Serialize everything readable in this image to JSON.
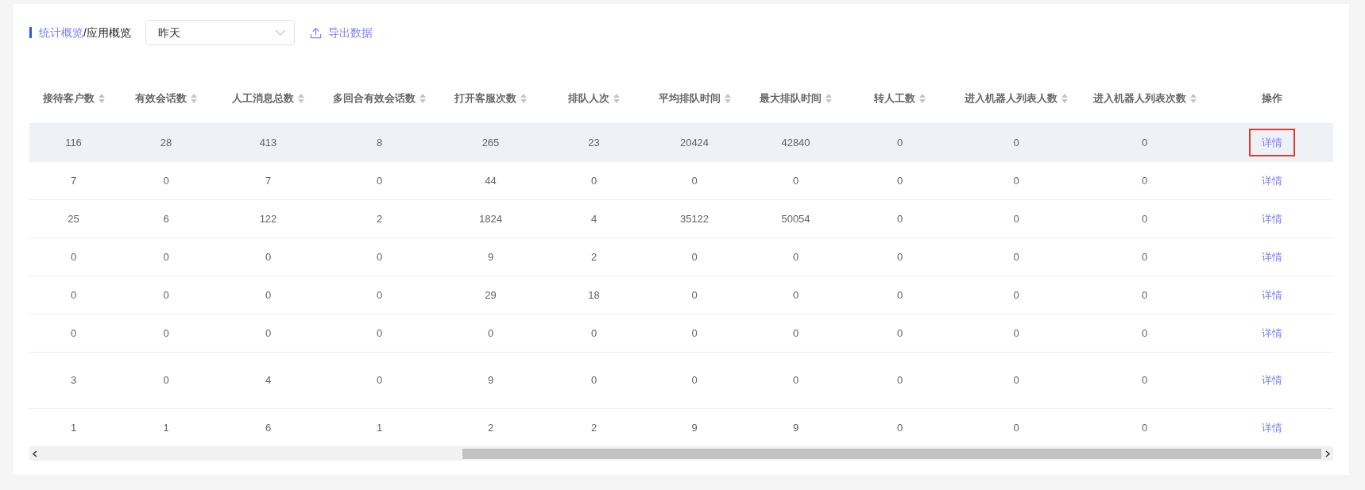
{
  "breadcrumb": {
    "parent": "统计概览",
    "separator": "/",
    "current": "应用概览"
  },
  "date_select": {
    "value": "昨天"
  },
  "export_button": {
    "label": "导出数据"
  },
  "table": {
    "columns": [
      {
        "label": "接待客户数",
        "sortable": true
      },
      {
        "label": "有效会话数",
        "sortable": true
      },
      {
        "label": "人工消息总数",
        "sortable": true
      },
      {
        "label": "多回合有效会话数",
        "sortable": true
      },
      {
        "label": "打开客服次数",
        "sortable": true
      },
      {
        "label": "排队人次",
        "sortable": true
      },
      {
        "label": "平均排队时间",
        "sortable": true
      },
      {
        "label": "最大排队时间",
        "sortable": true
      },
      {
        "label": "转人工数",
        "sortable": true
      },
      {
        "label": "进入机器人列表人数",
        "sortable": true
      },
      {
        "label": "进入机器人列表次数",
        "sortable": true
      },
      {
        "label": "操作",
        "sortable": false
      }
    ],
    "rows": [
      {
        "hovered": true,
        "tall": false,
        "cells": [
          "116",
          "28",
          "413",
          "8",
          "265",
          "23",
          "20424",
          "42840",
          "0",
          "0",
          "0"
        ],
        "action": "详情",
        "action_highlighted": true
      },
      {
        "hovered": false,
        "tall": false,
        "cells": [
          "7",
          "0",
          "7",
          "0",
          "44",
          "0",
          "0",
          "0",
          "0",
          "0",
          "0"
        ],
        "action": "详情",
        "action_highlighted": false
      },
      {
        "hovered": false,
        "tall": false,
        "cells": [
          "25",
          "6",
          "122",
          "2",
          "1824",
          "4",
          "35122",
          "50054",
          "0",
          "0",
          "0"
        ],
        "action": "详情",
        "action_highlighted": false
      },
      {
        "hovered": false,
        "tall": false,
        "cells": [
          "0",
          "0",
          "0",
          "0",
          "9",
          "2",
          "0",
          "0",
          "0",
          "0",
          "0"
        ],
        "action": "详情",
        "action_highlighted": false
      },
      {
        "hovered": false,
        "tall": false,
        "cells": [
          "0",
          "0",
          "0",
          "0",
          "29",
          "18",
          "0",
          "0",
          "0",
          "0",
          "0"
        ],
        "action": "详情",
        "action_highlighted": false
      },
      {
        "hovered": false,
        "tall": false,
        "cells": [
          "0",
          "0",
          "0",
          "0",
          "0",
          "0",
          "0",
          "0",
          "0",
          "0",
          "0"
        ],
        "action": "详情",
        "action_highlighted": false
      },
      {
        "hovered": false,
        "tall": true,
        "cells": [
          "3",
          "0",
          "4",
          "0",
          "9",
          "0",
          "0",
          "0",
          "0",
          "0",
          "0"
        ],
        "action": "详情",
        "action_highlighted": false
      },
      {
        "hovered": false,
        "tall": false,
        "cells": [
          "1",
          "1",
          "6",
          "1",
          "2",
          "2",
          "9",
          "9",
          "0",
          "0",
          "0"
        ],
        "action": "详情",
        "action_highlighted": false
      }
    ]
  }
}
